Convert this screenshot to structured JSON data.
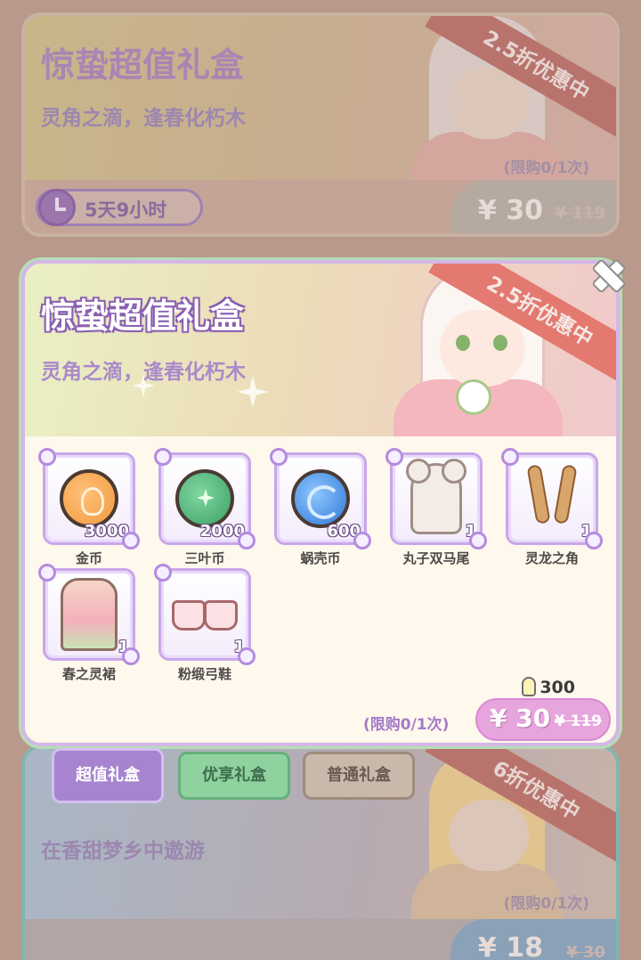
{
  "cards": [
    {
      "title": "惊蛰超值礼盒",
      "subtitle": "灵角之滴，逢春化朽木",
      "ribbon": "2.5折优惠中",
      "limit": "(限购0/1次)",
      "timer": "5天9小时",
      "price": "¥ 30",
      "old_price": "¥ 119"
    },
    {
      "title": "惊蛰超值礼盒",
      "subtitle": "灵角之滴，逢春化朽木",
      "ribbon": "2.5折优惠中",
      "limit": "(限购0/1次)",
      "price": "¥ 30",
      "old_price": "¥ 119",
      "energy": "300",
      "items": [
        {
          "name": "金币",
          "count": "3000",
          "icon": "gold-coin-icon"
        },
        {
          "name": "三叶币",
          "count": "2000",
          "icon": "clover-coin-icon"
        },
        {
          "name": "蜗壳币",
          "count": "600",
          "icon": "shell-coin-icon"
        },
        {
          "name": "丸子双马尾",
          "count": "1",
          "icon": "twin-bun-hair-icon"
        },
        {
          "name": "灵龙之角",
          "count": "1",
          "icon": "dragon-horn-icon"
        },
        {
          "name": "春之灵裙",
          "count": "1",
          "icon": "spring-dress-icon"
        },
        {
          "name": "粉缎弓鞋",
          "count": "1",
          "icon": "pink-shoes-icon"
        }
      ]
    },
    {
      "subtitle": "在香甜梦乡中遨游",
      "ribbon": "6折优惠中",
      "limit": "(限购0/1次)",
      "price": "¥ 18",
      "old_price": "¥ 30"
    }
  ],
  "tabs": [
    {
      "label": "超值礼盒",
      "active": true
    },
    {
      "label": "优享礼盒",
      "active": false
    },
    {
      "label": "普通礼盒",
      "active": false
    }
  ],
  "colors": {
    "accent": "#a784cf",
    "ribbon": "#e3796f",
    "buy": "#e7a5dd"
  }
}
